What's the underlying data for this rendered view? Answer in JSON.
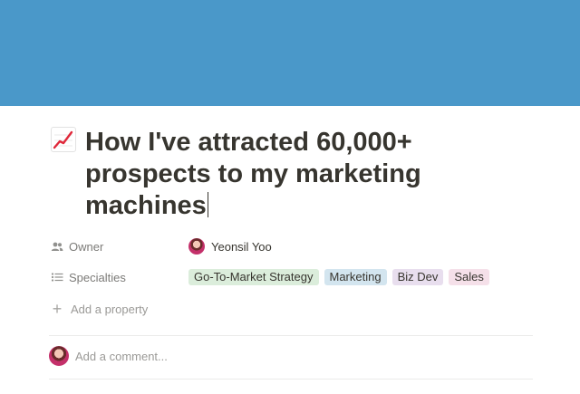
{
  "cover": {
    "color": "#4a98c9"
  },
  "page": {
    "icon": "chart-increasing-icon",
    "title_lines": [
      "How I've attracted 60,000+",
      "prospects to my marketing",
      "machines"
    ]
  },
  "properties": {
    "owner": {
      "label": "Owner",
      "icon": "people-icon",
      "value": "Yeonsil Yoo"
    },
    "specialties": {
      "label": "Specialties",
      "icon": "list-icon",
      "tags": [
        {
          "text": "Go-To-Market Strategy",
          "color": "#dbeddb"
        },
        {
          "text": "Marketing",
          "color": "#d3e5ef"
        },
        {
          "text": "Biz Dev",
          "color": "#e8deee"
        },
        {
          "text": "Sales",
          "color": "#f5e0e9"
        }
      ]
    },
    "add_property_label": "Add a property"
  },
  "comments": {
    "placeholder": "Add a comment..."
  }
}
